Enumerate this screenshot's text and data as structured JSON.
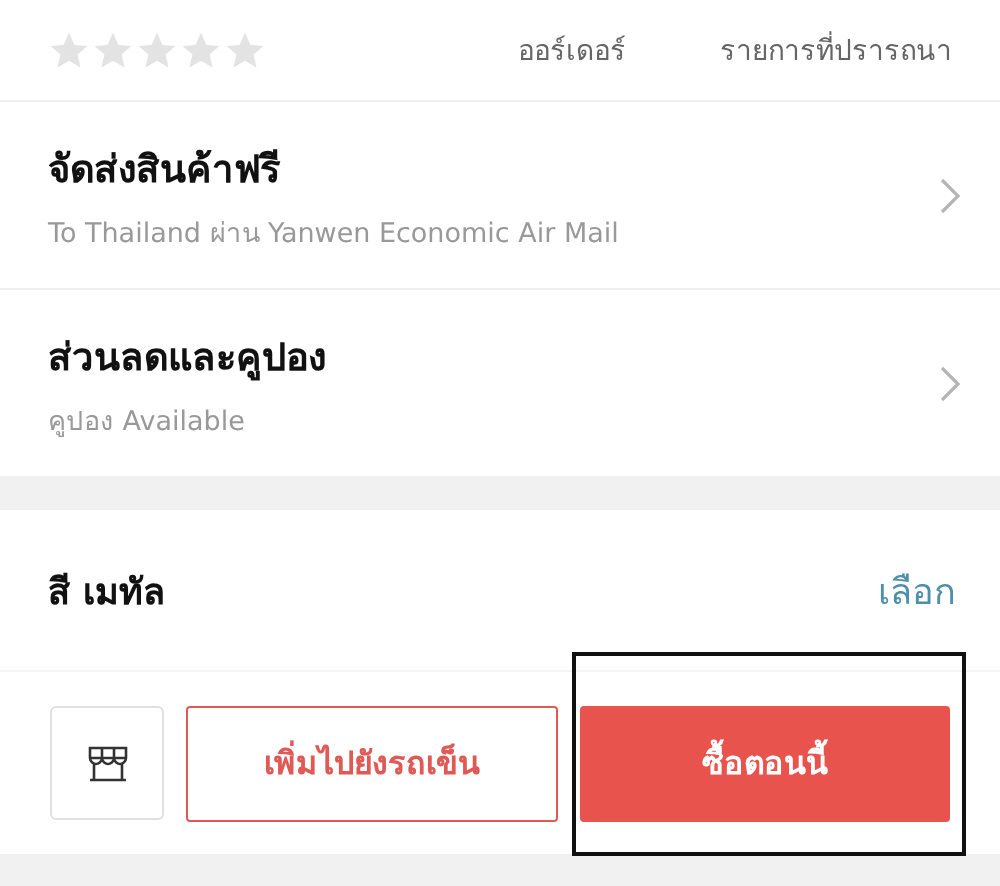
{
  "rating": {
    "stars": 0
  },
  "stats": [
    {
      "label": "ออร์เดอร์"
    },
    {
      "label": "รายการที่ปรารถนา"
    }
  ],
  "info_rows": [
    {
      "title": "จัดส่งสินค้าฟรี",
      "subtitle": "To Thailand ผ่าน Yanwen Economic Air Mail"
    },
    {
      "title": "ส่วนลดและคูปอง",
      "subtitle": "คูปอง Available"
    }
  ],
  "color_option": {
    "label": "สี เมทัล",
    "action": "เลือก"
  },
  "action_bar": {
    "add_to_cart": "เพิ่มไปยังรถเข็น",
    "buy_now": "ซื้อตอนนี้",
    "highlighted": true
  }
}
